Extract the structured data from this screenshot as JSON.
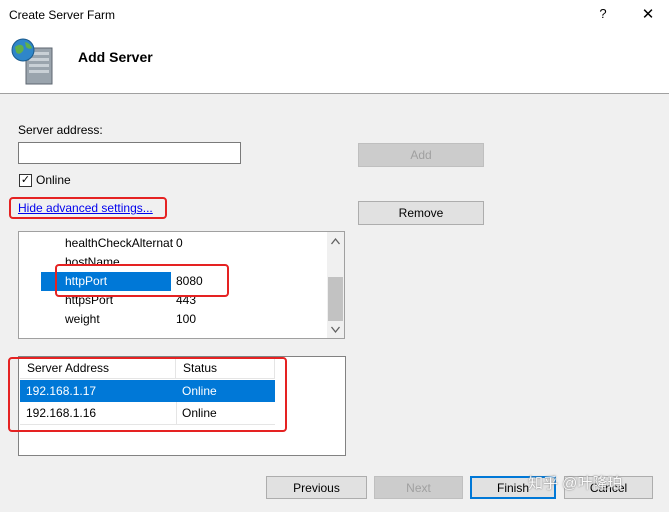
{
  "window": {
    "title": "Create Server Farm",
    "help_glyph": "?",
    "close_glyph": "✕"
  },
  "header": {
    "title": "Add Server"
  },
  "form": {
    "server_address_label": "Server address:",
    "server_address_value": "",
    "online_label": "Online",
    "online_checked": true,
    "advanced_link": "Hide advanced settings...",
    "add_button": "Add",
    "remove_button": "Remove"
  },
  "properties": [
    {
      "name": "healthCheckAlternat",
      "value": "0"
    },
    {
      "name": "hostName",
      "value": ""
    },
    {
      "name": "httpPort",
      "value": "8080"
    },
    {
      "name": "httpsPort",
      "value": "443"
    },
    {
      "name": "weight",
      "value": "100"
    }
  ],
  "server_list": {
    "columns": [
      "Server Address",
      "Status"
    ],
    "rows": [
      {
        "address": "192.168.1.17",
        "status": "Online"
      },
      {
        "address": "192.168.1.16",
        "status": "Online"
      }
    ]
  },
  "footer": {
    "previous": "Previous",
    "next": "Next",
    "finish": "Finish",
    "cancel": "Cancel"
  },
  "watermark": "知乎 @叶隆珀",
  "colors": {
    "selection": "#0078d7",
    "highlight_box": "#e52222"
  }
}
